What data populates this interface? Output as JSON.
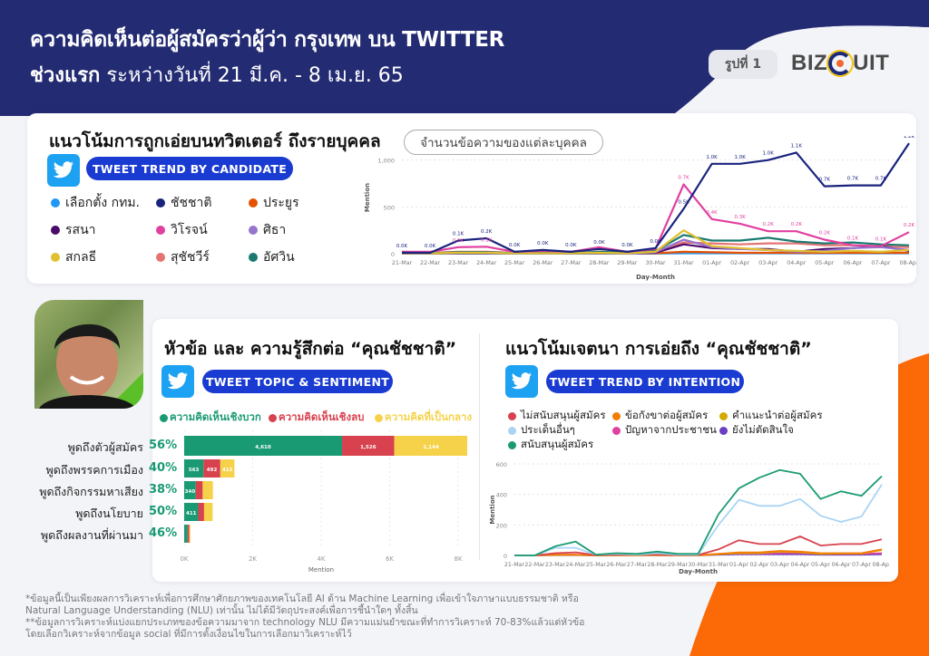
{
  "header": {
    "title_line1": "ความคิดเห็นต่อผู้สมัครว่าผู้ว่า กรุงเทพ บน TWITTER",
    "title_line2_bold": "ช่วงแรก",
    "title_line2_rest": " ระหว่างวันที่ 21 มี.ค. - 8 เม.ย. 65",
    "figure_badge": "รูปที่ 1",
    "logo_left": "BIZ",
    "logo_right": "UIT"
  },
  "colors": {
    "navy": "#232b72",
    "orange": "#fb6a07",
    "pill_blue": "#1a3bd1",
    "twitter_blue": "#1da1f2",
    "positive": "#1a9a73",
    "negative": "#d8414e",
    "neutral": "#f6d24a"
  },
  "section1": {
    "title": "แนวโน้มการถูกเอ่ยบนทวิตเตอร์ ถึงรายบุคคล",
    "pill": "TWEET TREND BY CANDIDATE",
    "caption": "จำนวนข้อความของแต่ละบุคคล",
    "legend": [
      {
        "label": "เลือกตั้ง กทม.",
        "color": "#2196f3"
      },
      {
        "label": "ชัชชาติ",
        "color": "#1a237e"
      },
      {
        "label": "ประยูร",
        "color": "#e65100"
      },
      {
        "label": "รสนา",
        "color": "#4a0a6b"
      },
      {
        "label": "วิโรจน์",
        "color": "#e040a0"
      },
      {
        "label": "ศิธา",
        "color": "#9575cd"
      },
      {
        "label": "สกลธี",
        "color": "#e0c030"
      },
      {
        "label": "สุชัชวีร์",
        "color": "#e57373"
      },
      {
        "label": "อัศวิน",
        "color": "#1a7a70"
      }
    ]
  },
  "section2": {
    "title": "หัวข้อ และ ความรู้สึกต่อ “คุณชัชชาติ”",
    "pill": "TWEET TOPIC & SENTIMENT",
    "sentiment_legend": [
      {
        "label": "ความคิดเห็นเชิงบวก",
        "color": "#1a9a73"
      },
      {
        "label": "ความคิดเห็นเชิงลบ",
        "color": "#d8414e"
      },
      {
        "label": "ความคิดที่เป็นกลาง",
        "color": "#f6d24a"
      }
    ]
  },
  "section3": {
    "title": "แนวโน้มเจตนา การเอ่ยถึง “คุณชัชชาติ”",
    "pill": "TWEET TREND BY INTENTION",
    "legend": [
      {
        "label": "ไม่สนับสนุนผู้สมัคร",
        "color": "#d8414e"
      },
      {
        "label": "ข้อกังขาต่อผู้สมัคร",
        "color": "#f57c00"
      },
      {
        "label": "คำแนะนำต่อผู้สมัคร",
        "color": "#d4a900"
      },
      {
        "label": "ประเด็นอื่นๆ",
        "color": "#a9d4f5"
      },
      {
        "label": "ปัญหาจากประชาชน",
        "color": "#e040a0"
      },
      {
        "label": "ยังไม่ตัดสินใจ",
        "color": "#6a3fc1"
      },
      {
        "label": "สนับสนุนผู้สมัคร",
        "color": "#1a9a73"
      }
    ]
  },
  "footnote": {
    "line1": "*ข้อมูลนี้เป็นเพียงผลการวิเคราะห์เพื่อการศึกษาศักยภาพของเทคโนโลยี AI ด้าน Machine Learning เพื่อเข้าใจภาษาแบบธรรมชาติ หรือ",
    "line2": "Natural Language Understanding (NLU) เท่านั้น ไม่ได้มีวัตถุประสงค์เพื่อการชี้นำใดๆ ทั้งสิ้น",
    "line3": "**ข้อมูลการวิเคราะห์แบ่งแยกประเภทของข้อความมาจาก technology NLU มีความแม่นยำขณะที่ทำการวิเคราะห์ 70-83%แล้วแต่หัวข้อ",
    "line4": "โดยเลือกวิเคราะห์จากข้อมูล social ที่มีการตั้งเงื่อนไขในการเลือกมาวิเคราะห์ไว้"
  },
  "chart_data": [
    {
      "type": "line",
      "title": "Tweet trend by candidate",
      "xlabel": "Day-Month",
      "ylabel": "Mention",
      "ylim": [
        0,
        1200
      ],
      "yticks": [
        0,
        500,
        1000
      ],
      "ytick_labels": [
        "0",
        "500",
        "1,000"
      ],
      "grid": true,
      "x": [
        "21-Mar",
        "22-Mar",
        "23-Mar",
        "24-Mar",
        "25-Mar",
        "26-Mar",
        "27-Mar",
        "28-Mar",
        "29-Mar",
        "30-Mar",
        "31-Mar",
        "01-Apr",
        "02-Apr",
        "03-Apr",
        "04-Apr",
        "05-Apr",
        "06-Apr",
        "07-Apr",
        "08-Apr"
      ],
      "series": [
        {
          "name": "ชัชชาติ",
          "color": "#1a237e",
          "values": [
            10,
            10,
            140,
            165,
            20,
            40,
            20,
            50,
            20,
            60,
            480,
            960,
            960,
            1000,
            1080,
            720,
            730,
            730,
            1180
          ],
          "labels": [
            "0.0K",
            "0.0K",
            "0.1K",
            "0.2K",
            "0.0K",
            "0.0K",
            "0.0K",
            "0.0K",
            "0.0K",
            "0.0K",
            "0.5K",
            "1.0K",
            "1.0K",
            "1.0K",
            "1.1K",
            "0.7K",
            "0.7K",
            "0.7K",
            "1.2K"
          ]
        },
        {
          "name": "วิโรจน์",
          "color": "#e040a0",
          "values": [
            20,
            20,
            70,
            75,
            20,
            30,
            20,
            70,
            20,
            50,
            740,
            370,
            320,
            240,
            240,
            150,
            90,
            80,
            230
          ],
          "labels": [
            "",
            "",
            "0.1K",
            "0.1K",
            "",
            "",
            "",
            "",
            "",
            "",
            "0.7K",
            "0.4K",
            "0.3K",
            "0.2K",
            "0.2K",
            "0.2K",
            "0.1K",
            "0.1K",
            "0.2K"
          ]
        },
        {
          "name": "สกลธี",
          "color": "#e0c030",
          "values": [
            5,
            5,
            10,
            10,
            5,
            5,
            5,
            10,
            5,
            20,
            250,
            80,
            60,
            40,
            30,
            20,
            30,
            20,
            40
          ]
        },
        {
          "name": "อัศวิน",
          "color": "#1a7a70",
          "values": [
            5,
            5,
            15,
            15,
            5,
            10,
            5,
            20,
            10,
            30,
            200,
            140,
            140,
            170,
            130,
            110,
            120,
            100,
            90
          ]
        },
        {
          "name": "ศิธา",
          "color": "#9575cd",
          "values": [
            5,
            5,
            10,
            10,
            5,
            5,
            5,
            10,
            5,
            15,
            150,
            70,
            50,
            40,
            20,
            30,
            60,
            70,
            40
          ]
        },
        {
          "name": "รสนา",
          "color": "#4a0a6b",
          "values": [
            5,
            5,
            5,
            5,
            5,
            5,
            5,
            5,
            5,
            10,
            100,
            60,
            50,
            50,
            20,
            50,
            60,
            80,
            30
          ]
        },
        {
          "name": "สุชัชวีร์",
          "color": "#e57373",
          "values": [
            10,
            10,
            20,
            20,
            10,
            10,
            10,
            20,
            10,
            20,
            120,
            110,
            100,
            110,
            110,
            90,
            90,
            80,
            70
          ]
        },
        {
          "name": "ประยูร",
          "color": "#e65100",
          "values": [
            5,
            5,
            5,
            5,
            5,
            5,
            5,
            5,
            5,
            5,
            20,
            15,
            10,
            10,
            10,
            10,
            10,
            10,
            10
          ]
        },
        {
          "name": "เลือกตั้ง กทม.",
          "color": "#2196f3",
          "values": [
            2,
            2,
            2,
            2,
            2,
            2,
            2,
            2,
            2,
            2,
            5,
            5,
            5,
            5,
            5,
            5,
            5,
            5,
            5
          ]
        }
      ]
    },
    {
      "type": "bar",
      "orientation": "horizontal",
      "stacked": true,
      "title": "Tweet topic & sentiment",
      "xlabel": "Mention",
      "xlim": [
        0,
        8000
      ],
      "xticks": [
        "0K",
        "2K",
        "4K",
        "6K",
        "8K"
      ],
      "categories": [
        "พูดถึงตัวผู้สมัคร",
        "พูดถึงพรรคการเมือง",
        "พูดถึงกิจกรรมหาเสียง",
        "พูดถึงนโยบาย",
        "พูดถึงผลงานที่ผ่านมา"
      ],
      "percent_labels": [
        "56%",
        "40%",
        "38%",
        "50%",
        "46%"
      ],
      "series": [
        {
          "name": "ความคิดเห็นเชิงบวก",
          "color": "#1a9a73",
          "values": [
            4610,
            563,
            340,
            411,
            100
          ],
          "labels": [
            "4,610",
            "563",
            "340",
            "411",
            ""
          ]
        },
        {
          "name": "ความคิดเห็นเชิงลบ",
          "color": "#d8414e",
          "values": [
            1526,
            492,
            200,
            170,
            50
          ],
          "labels": [
            "1,526",
            "492",
            "",
            "",
            ""
          ]
        },
        {
          "name": "ความคิดที่เป็นกลาง",
          "color": "#f6d24a",
          "values": [
            2144,
            413,
            300,
            250,
            30
          ],
          "labels": [
            "2,144",
            "413",
            "",
            "",
            ""
          ]
        }
      ]
    },
    {
      "type": "line",
      "title": "Tweet trend by intention",
      "xlabel": "Day-Month",
      "ylabel": "Mention",
      "ylim": [
        0,
        600
      ],
      "yticks": [
        0,
        200,
        400,
        600
      ],
      "ytick_labels": [
        "0",
        "200",
        "400",
        "600"
      ],
      "grid": true,
      "x": [
        "21-Mar",
        "22-Mar",
        "23-Mar",
        "24-Mar",
        "25-Mar",
        "26-Mar",
        "27-Mar",
        "28-Mar",
        "29-Mar",
        "30-Mar",
        "31-Mar",
        "01-Apr",
        "02-Apr",
        "03-Apr",
        "04-Apr",
        "05-Apr",
        "06-Apr",
        "07-Apr",
        "08-Apr"
      ],
      "series": [
        {
          "name": "สนับสนุนผู้สมัคร",
          "color": "#1a9a73",
          "values": [
            0,
            0,
            60,
            90,
            5,
            15,
            10,
            25,
            10,
            10,
            270,
            440,
            510,
            560,
            535,
            370,
            420,
            390,
            520
          ]
        },
        {
          "name": "ประเด็นอื่นๆ",
          "color": "#a9d4f5",
          "values": [
            0,
            0,
            50,
            50,
            5,
            10,
            5,
            15,
            5,
            5,
            200,
            365,
            325,
            325,
            370,
            260,
            220,
            255,
            465
          ]
        },
        {
          "name": "ไม่สนับสนุนผู้สมัคร",
          "color": "#d8414e",
          "values": [
            0,
            0,
            15,
            20,
            2,
            5,
            5,
            8,
            3,
            3,
            40,
            100,
            75,
            75,
            125,
            65,
            75,
            75,
            105
          ]
        },
        {
          "name": "ข้อกังขาต่อผู้สมัคร",
          "color": "#f57c00",
          "values": [
            0,
            0,
            5,
            5,
            0,
            2,
            2,
            3,
            1,
            1,
            10,
            20,
            20,
            30,
            25,
            15,
            15,
            15,
            40
          ]
        },
        {
          "name": "คำแนะนำต่อผู้สมัคร",
          "color": "#d4a900",
          "values": [
            0,
            0,
            3,
            3,
            0,
            1,
            1,
            2,
            1,
            1,
            8,
            15,
            15,
            25,
            20,
            10,
            12,
            12,
            35
          ]
        },
        {
          "name": "ปัญหาจากประชาชน",
          "color": "#e040a0",
          "values": [
            0,
            0,
            5,
            5,
            0,
            2,
            2,
            3,
            1,
            1,
            10,
            12,
            12,
            15,
            15,
            10,
            10,
            10,
            15
          ]
        },
        {
          "name": "ยังไม่ตัดสินใจ",
          "color": "#6a3fc1",
          "values": [
            0,
            0,
            2,
            2,
            0,
            1,
            1,
            1,
            0,
            0,
            5,
            8,
            8,
            8,
            8,
            5,
            5,
            5,
            8
          ]
        }
      ]
    }
  ]
}
